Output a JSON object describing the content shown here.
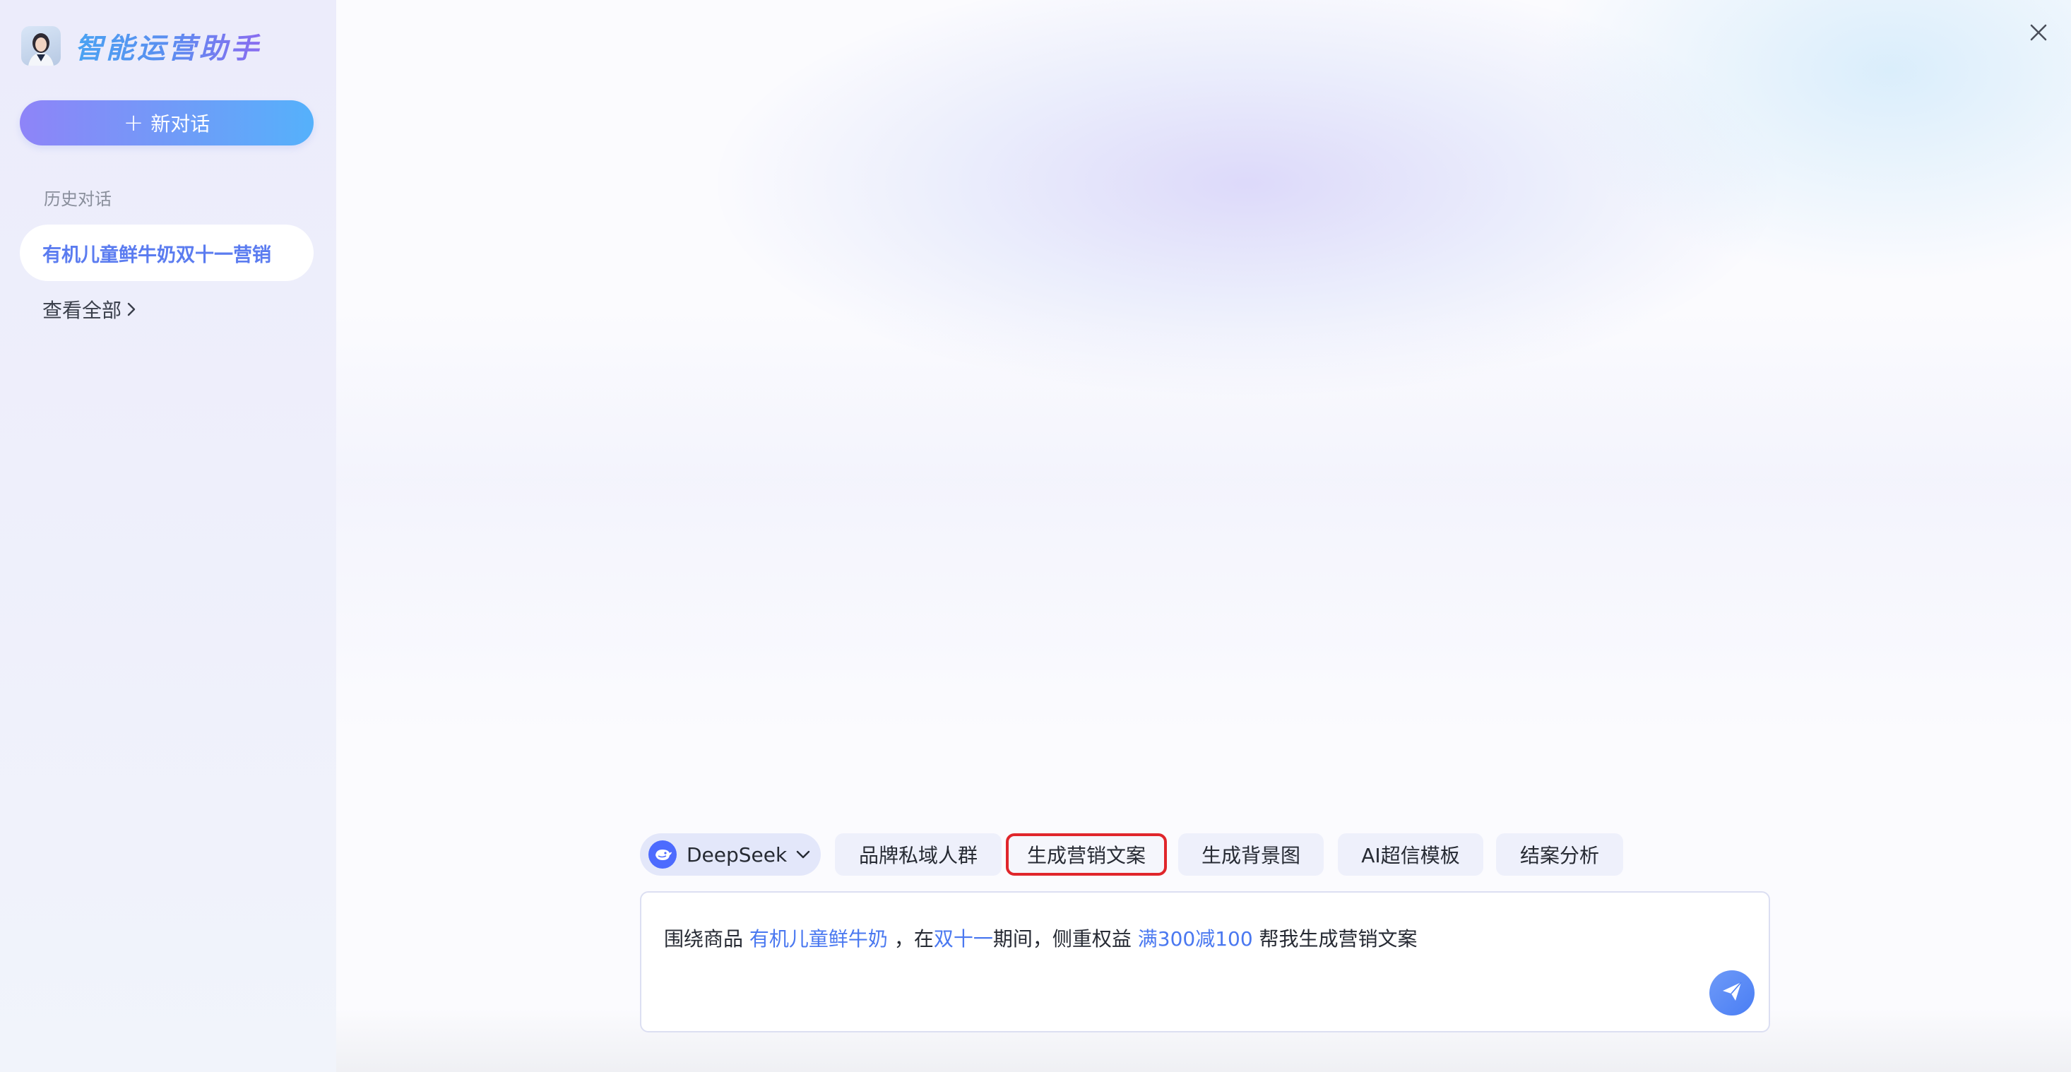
{
  "sidebar": {
    "brand_title": "智能运营助手",
    "new_chat_label": "新对话",
    "history_label": "历史对话",
    "history_items": [
      {
        "label": "有机儿童鲜牛奶双十一营销"
      }
    ],
    "view_all_label": "查看全部"
  },
  "toolbar": {
    "model_label": "DeepSeek",
    "chips": [
      {
        "label": "品牌私域人群"
      },
      {
        "label": "生成营销文案",
        "selected": true
      },
      {
        "label": "生成背景图"
      },
      {
        "label": "AI超信模板"
      },
      {
        "label": "结案分析"
      }
    ]
  },
  "input": {
    "parts": [
      "围绕商品 ",
      "有机儿童鲜牛奶",
      " ，在",
      "双十一",
      "期间，侧重权益 ",
      "满300减100",
      " 帮我生成营销文案"
    ]
  },
  "colors": {
    "accent_blue": "#4a78f0",
    "highlight_border": "#e0262b",
    "button_gradient_start": "#8e84f8",
    "button_gradient_end": "#55b1fb"
  },
  "icons": {
    "close": "close-icon",
    "send": "send-icon",
    "model": "deepseek-whale-icon",
    "dropdown": "chevron-down-icon",
    "view_all": "chevron-right-icon"
  }
}
